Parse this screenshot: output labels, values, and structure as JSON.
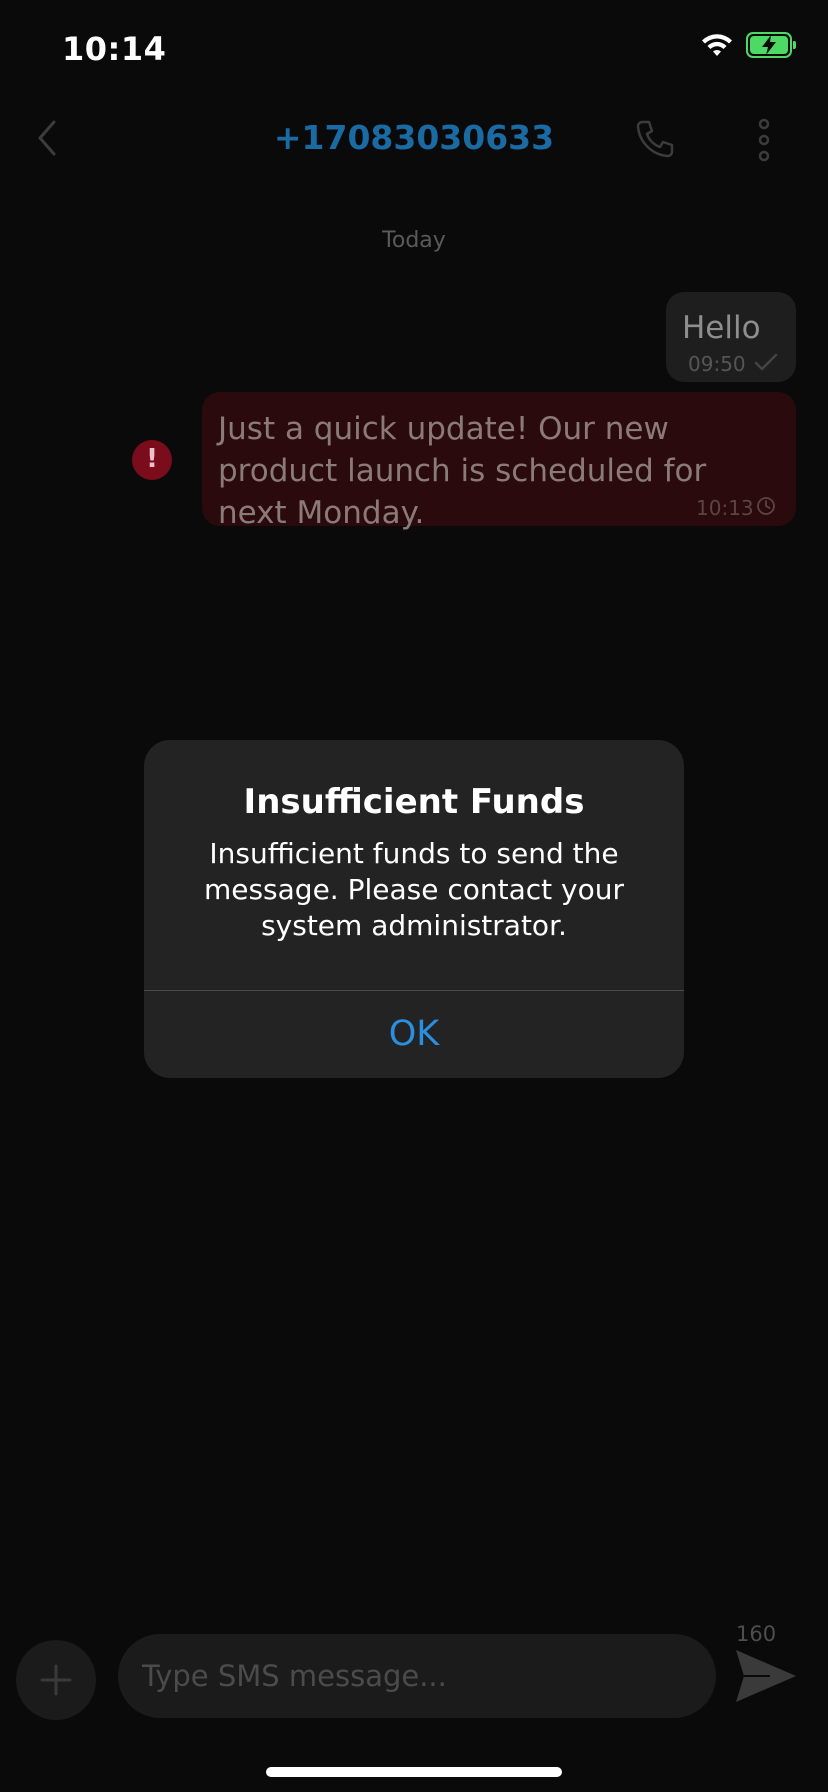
{
  "status_bar": {
    "time": "10:14",
    "battery_color": "#4cd964"
  },
  "header": {
    "contact": "+17083030633",
    "back_icon": "chevron-left-icon",
    "call_icon": "phone-icon",
    "menu_icon": "more-vertical-icon"
  },
  "conversation": {
    "date_label": "Today",
    "messages": [
      {
        "text": "Hello",
        "time": "09:50",
        "status": "delivered"
      },
      {
        "text": "Just a quick update! Our new product launch is scheduled for next Monday.",
        "time": "10:13",
        "status": "failed"
      }
    ]
  },
  "alert": {
    "title": "Insufficient Funds",
    "message": "Insufficient funds to send the message. Please contact your system administrator.",
    "ok_label": "OK",
    "button_color": "#2a8fe0"
  },
  "composer": {
    "placeholder": "Type SMS message...",
    "char_counter": "160",
    "add_icon": "plus-icon",
    "send_icon": "send-icon"
  }
}
